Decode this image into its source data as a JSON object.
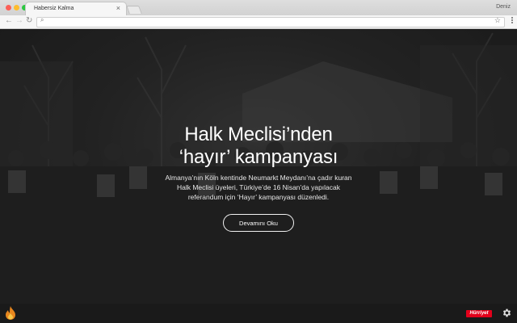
{
  "browser": {
    "tab_title": "Habersiz Kalma",
    "tab_close": "×",
    "profile_name": "Deniz",
    "nav_back": "←",
    "nav_forward": "→",
    "nav_reload": "↻",
    "omnibox_value": "",
    "omnibox_search_icon": "⌕",
    "bookmark_star": "☆"
  },
  "article": {
    "headline_line1": "Halk Meclisi’nden",
    "headline_line2": "‘hayır’ kampanyası",
    "summary_line1": "Almanya’nın Köln kentinde Neumarkt Meydanı’na çadır kuran",
    "summary_line2": "Halk Meclisi üyeleri, Türkiye’de 16 Nisan’da yapılacak",
    "summary_line3": "referandum için ‘Hayır’ kampanyası düzenledi.",
    "cta_label": "Devamını Oku"
  },
  "footer": {
    "brand": "Hürriyet",
    "brand_color": "#e3001b",
    "left_icon": "fire-icon",
    "right_icon": "gear-icon"
  }
}
